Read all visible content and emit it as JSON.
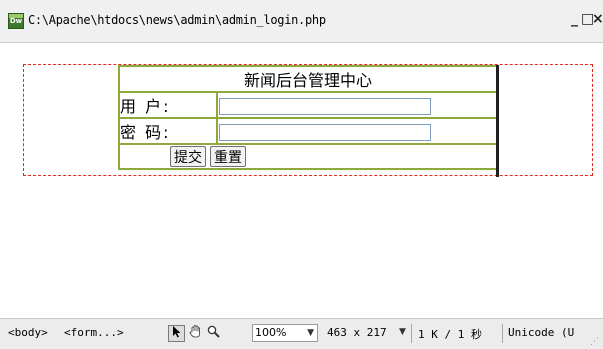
{
  "window": {
    "title_path": "C:\\Apache\\htdocs\\news\\admin\\admin_login.php",
    "app_icon_text": "Dw",
    "minimize_glyph": "_",
    "maximize_glyph": "□",
    "close_glyph": "×"
  },
  "form": {
    "title": "新闻后台管理中心",
    "username_label": "用 户:",
    "password_label": "密 码:",
    "username_value": "",
    "password_value": "",
    "submit_label": "提交",
    "reset_label": "重置"
  },
  "status_bar": {
    "tag_body": "<body>",
    "tag_form": "<form...>",
    "zoom": "100%",
    "dimensions": "463 x 217",
    "file_size": "1 K / 1 秒",
    "encoding": "Unicode (U"
  },
  "icons": {
    "select": "select-arrow-icon",
    "hand": "hand-icon",
    "zoom": "zoom-icon"
  },
  "colors": {
    "table_border": "#8fa83b",
    "form_outline": "#e0281e",
    "input_border": "#7f9db9"
  }
}
